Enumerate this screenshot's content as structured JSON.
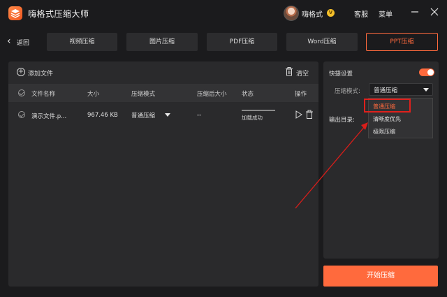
{
  "app": {
    "title": "嗨格式压缩大师"
  },
  "header": {
    "username": "嗨格式",
    "vip_badge": "V",
    "service_label": "客服",
    "menu_label": "菜单"
  },
  "nav": {
    "back_label": "返回",
    "tabs": [
      {
        "label": "视频压缩",
        "active": false
      },
      {
        "label": "图片压缩",
        "active": false
      },
      {
        "label": "PDF压缩",
        "active": false
      },
      {
        "label": "Word压缩",
        "active": false
      },
      {
        "label": "PPT压缩",
        "active": true
      }
    ]
  },
  "file_panel": {
    "add_file_label": "添加文件",
    "clear_label": "清空",
    "columns": [
      "文件名称",
      "大小",
      "压缩模式",
      "压缩后大小",
      "状态",
      "操作"
    ],
    "rows": [
      {
        "name": "演示文件.p...",
        "size": "967.46 KB",
        "mode": "普通压缩",
        "compressed_size": "--",
        "status": "加载成功"
      }
    ]
  },
  "settings": {
    "quick_settings_label": "快捷设置",
    "quick_settings_on": true,
    "mode_label": "压缩模式:",
    "mode_value": "普通压缩",
    "output_label": "输出目录:",
    "mode_options": [
      {
        "label": "普通压缩",
        "selected": true
      },
      {
        "label": "清晰度优先",
        "selected": false
      },
      {
        "label": "极限压缩",
        "selected": false
      }
    ]
  },
  "start_button_label": "开始压缩",
  "colors": {
    "accent": "#ff6a3d",
    "annotation": "#e0201c",
    "background": "#1b1b1d",
    "panel": "#2a2a2c"
  }
}
